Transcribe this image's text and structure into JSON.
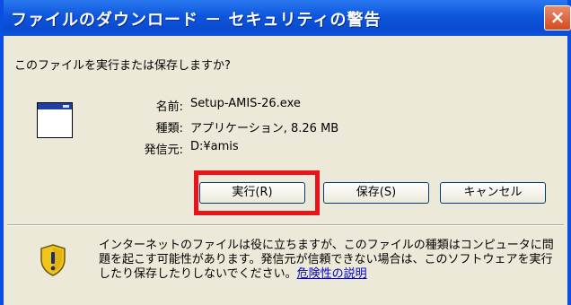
{
  "window": {
    "title": "ファイルのダウンロード － セキュリティの警告",
    "close_symbol": "×"
  },
  "dialog": {
    "question": "このファイルを実行または保存しますか?",
    "file_icon": "application-window-icon",
    "info": [
      {
        "label": "名前:",
        "value": "Setup-AMIS-26.exe"
      },
      {
        "label": "種類:",
        "value": "アプリケーション, 8.26 MB"
      },
      {
        "label": "発信元:",
        "value": "D:¥amis"
      }
    ]
  },
  "buttons": {
    "run_label": "実行(R)",
    "save_label": "保存(S)",
    "cancel_label": "キャンセル"
  },
  "warning": {
    "icon": "shield-warning-icon",
    "text": "インターネットのファイルは役に立ちますが、このファイルの種類はコンピュータに問題を起こす可能性があります。発信元が信頼できない場合は、このソフトウェアを実行したり保存したりしないでください。",
    "link_text": "危険性の説明"
  },
  "highlight_color": "#e8131b"
}
